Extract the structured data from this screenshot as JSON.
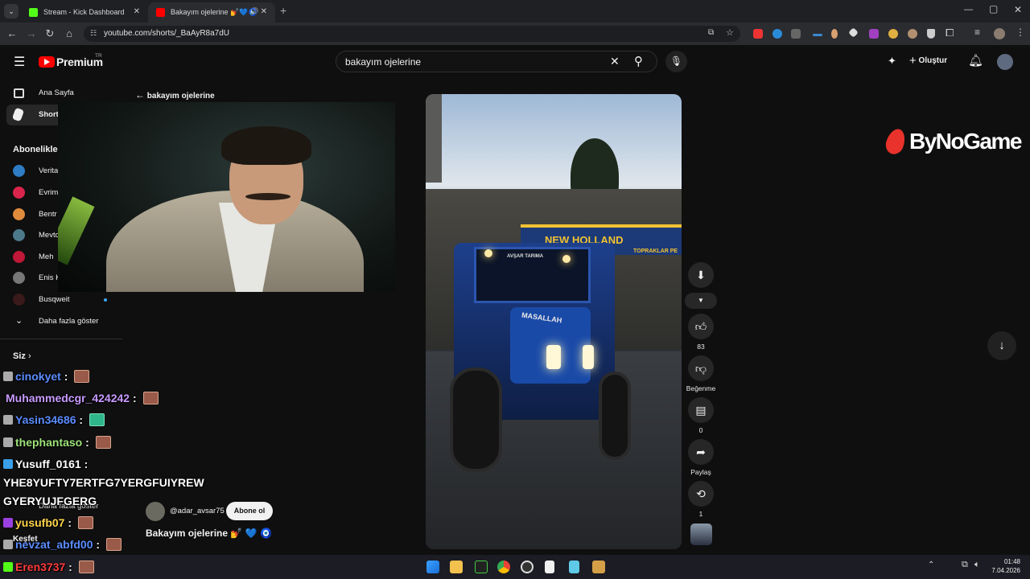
{
  "browser": {
    "tabs": [
      {
        "label": "Stream - Kick Dashboard"
      },
      {
        "label": "Bakayım ojelerine 💅💙🧿"
      }
    ],
    "url": "youtube.com/shorts/_BaAyR8a7dU"
  },
  "youtube": {
    "brand": "Premium",
    "region": "TR",
    "search_value": "bakayım ojelerine",
    "create_label": "Oluştur",
    "back_label": "bakayım ojelerine"
  },
  "sidebar": {
    "home": "Ana Sayfa",
    "shorts": "Shorts",
    "subs_title": "Abonelikler",
    "channels": [
      "Verita",
      "Evrim",
      "Bentr",
      "Mevtc",
      "Meh",
      "Enis K",
      "Busqweit"
    ],
    "more": "Daha fazla göster",
    "you": "Siz",
    "more2": "Daha fazla göster",
    "explore": "Keşfet"
  },
  "chat": [
    {
      "user": "cinokyet",
      "text": " : ",
      "color": "#5b8cff"
    },
    {
      "user": "Muhammedcgr_424242",
      "text": " : ",
      "color": "#c89bff"
    },
    {
      "user": "Yasin34686",
      "text": " : ",
      "color": "#5b8cff"
    },
    {
      "user": "thephantaso",
      "text": " : ",
      "color": "#9de37a"
    },
    {
      "user": "Yusuff_0161",
      "text": " :",
      "color": "#ffffff"
    },
    {
      "user": "YHE8YUFTY7ERTFG7YERGFUIYREW",
      "text": "",
      "color": "#ffffff"
    },
    {
      "user": "GYERYUJFGERG",
      "text": "",
      "color": "#ffffff"
    },
    {
      "user": "yusufb07",
      "text": " : ",
      "color": "#ffd34a"
    },
    {
      "user": "nevzat_abfd00",
      "text": " : ",
      "color": "#5b8cff"
    },
    {
      "user": "Eren3737",
      "text": " : ",
      "color": "#ff3b3b"
    }
  ],
  "video": {
    "channel": "@adar_avsar75",
    "subscribe": "Abone ol",
    "title": "Bakayım ojelerine 💅 💙 🧿",
    "sign_new_holland": "NEW HOLLAND",
    "sign_toprak": "TOPRAKLAR PE",
    "sign_avsar": "AVŞAR TARIMA",
    "hood_text": "MASALLAH"
  },
  "actions": {
    "likes": "83",
    "dislike": "Beğenme",
    "comments": "0",
    "share": "Paylaş",
    "remix": "1"
  },
  "overlay_logo": "ByNoGame",
  "taskbar": {
    "time": "01:48",
    "date": "7.04.2026"
  },
  "colors": {
    "yt_red": "#ff0000",
    "kick_green": "#53fc18"
  }
}
